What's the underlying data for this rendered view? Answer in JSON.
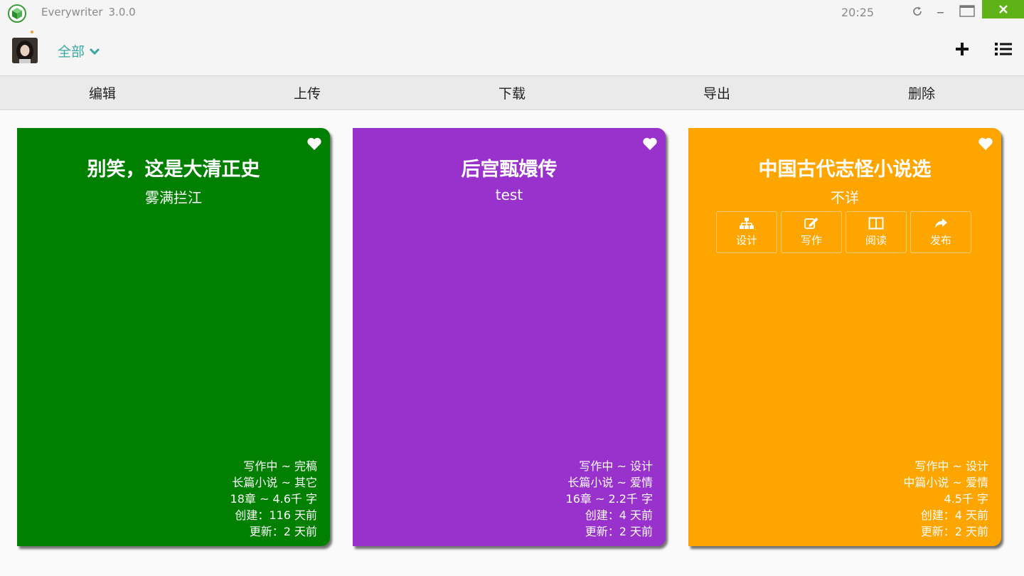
{
  "window": {
    "app_name": "Everywriter",
    "version": "3.0.0",
    "clock": "20:25",
    "accent_close": "#5fb319"
  },
  "topbar": {
    "category": "全部",
    "category_color": "#3aa8a0",
    "icons": [
      "avatar",
      "chevron-down-icon",
      "plus-icon",
      "list-icon"
    ]
  },
  "toolbar": {
    "edit": "编辑",
    "upload": "上传",
    "download": "下载",
    "export": "导出",
    "delete": "删除"
  },
  "books": [
    {
      "title": "别笑，这是大清正史",
      "author": "雾满拦江",
      "color": "#007f00",
      "status": "写作中 ~ 完稿",
      "genre": "长篇小说 ~ 其它",
      "size": "18章 ~ 4.6千 字",
      "created": "创建：116 天前",
      "updated": "更新：2 天前"
    },
    {
      "title": "后宫甄嬛传",
      "author": "test",
      "color": "#9932cc",
      "status": "写作中 ~ 设计",
      "genre": "长篇小说 ~ 爱情",
      "size": "16章 ~ 2.2千 字",
      "created": "创建：4 天前",
      "updated": "更新：2 天前"
    },
    {
      "title": "中国古代志怪小说选",
      "author": "不详",
      "color": "#ffa500",
      "status": "写作中 ~ 设计",
      "genre": "中篇小说 ~ 爱情",
      "size": "4.5千 字",
      "created": "创建：4 天前",
      "updated": "更新：2 天前",
      "actions": [
        "设计",
        "写作",
        "阅读",
        "发布"
      ]
    }
  ]
}
